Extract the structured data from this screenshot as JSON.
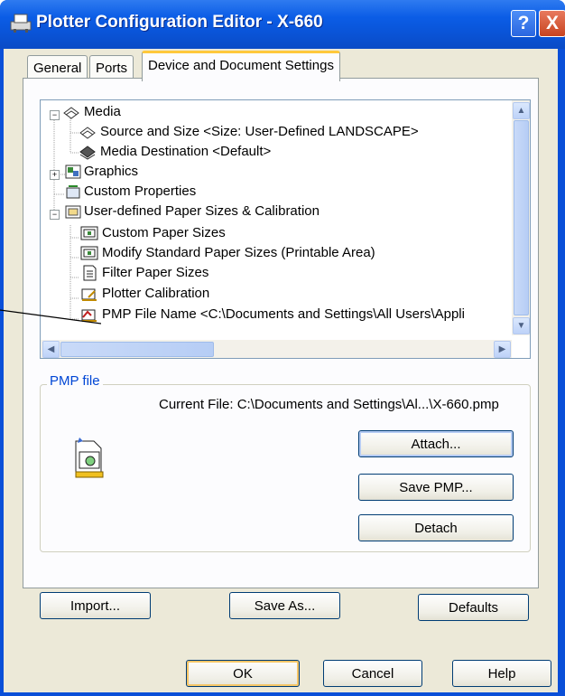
{
  "window": {
    "title": "Plotter Configuration Editor - X-660",
    "help_glyph": "?",
    "close_glyph": "X"
  },
  "tabs": [
    {
      "label": "General",
      "active": false
    },
    {
      "label": "Ports",
      "active": false
    },
    {
      "label": "Device and Document Settings",
      "active": true
    }
  ],
  "tree": {
    "items": [
      {
        "label": "Media",
        "expander": "−",
        "icon": "media-icon"
      },
      {
        "label": "Source and Size <Size: User-Defined LANDSCAPE>",
        "icon": "source-size-icon"
      },
      {
        "label": "Media Destination <Default>",
        "icon": "media-destination-icon"
      },
      {
        "label": "Graphics",
        "expander": "+",
        "icon": "graphics-icon"
      },
      {
        "label": "Custom Properties",
        "icon": "custom-properties-icon"
      },
      {
        "label": "User-defined Paper Sizes & Calibration",
        "expander": "−",
        "icon": "paper-sizes-icon"
      },
      {
        "label": "Custom Paper Sizes",
        "icon": "custom-paper-sizes-icon"
      },
      {
        "label": "Modify Standard Paper Sizes (Printable Area)",
        "icon": "modify-paper-icon"
      },
      {
        "label": "Filter Paper Sizes",
        "icon": "filter-paper-icon"
      },
      {
        "label": "Plotter Calibration",
        "icon": "calibration-icon"
      },
      {
        "label": "PMP File Name <C:\\Documents and Settings\\All Users\\Appli",
        "icon": "pmp-file-icon",
        "selected": true
      }
    ]
  },
  "pmp_group": {
    "title": "PMP file",
    "current_file": "Current File: C:\\Documents and Settings\\Al...\\X-660.pmp",
    "attach_label": "Attach...",
    "save_pmp_label": "Save PMP...",
    "detach_label": "Detach"
  },
  "panel_buttons": {
    "import_label": "Import...",
    "save_as_label": "Save As...",
    "defaults_label": "Defaults"
  },
  "dialog_buttons": {
    "ok_label": "OK",
    "cancel_label": "Cancel",
    "help_label": "Help"
  },
  "colors": {
    "title_bar": "#0a53d6",
    "dialog_face": "#ece9d8",
    "group_title": "#0046d5",
    "default_button_glow": "#f5c566"
  }
}
